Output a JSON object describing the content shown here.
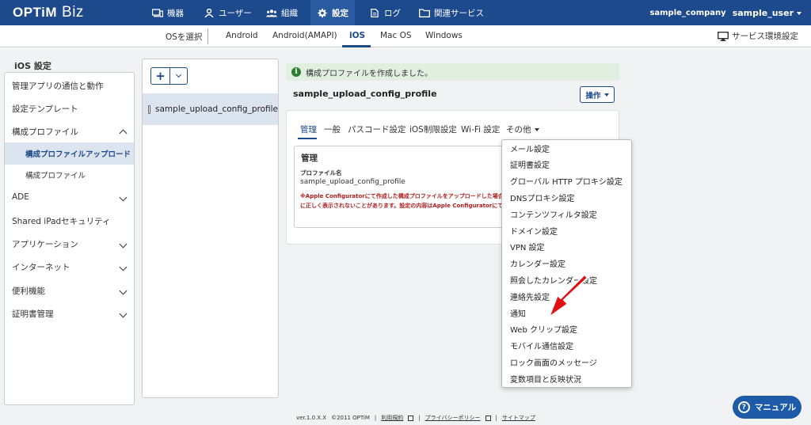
{
  "header": {
    "logo": "OPTiM",
    "logo_suffix": "Biz",
    "nav": [
      {
        "label": "機器",
        "icon": "devices-icon"
      },
      {
        "label": "ユーザー",
        "icon": "user-icon"
      },
      {
        "label": "組織",
        "icon": "organization-icon"
      },
      {
        "label": "設定",
        "icon": "gear-icon"
      },
      {
        "label": "ログ",
        "icon": "log-icon"
      },
      {
        "label": "関連サービス",
        "icon": "folder-icon"
      }
    ],
    "company": "sample_company",
    "user": "sample_user"
  },
  "osbar": {
    "label": "OSを選択",
    "tabs": [
      "Android",
      "Android(AMAPI)",
      "iOS",
      "Mac OS",
      "Windows"
    ],
    "active": "iOS",
    "service_env": "サービス環境設定"
  },
  "sidebar": {
    "title": "iOS 設定",
    "items": [
      {
        "label": "管理アプリの通信と動作"
      },
      {
        "label": "設定テンプレート"
      },
      {
        "label": "構成プロファイル"
      },
      {
        "label": "構成プロファイルアップロード"
      },
      {
        "label": "構成プロファイル"
      },
      {
        "label": "ADE"
      },
      {
        "label": "Shared iPadセキュリティ"
      },
      {
        "label": "アプリケーション"
      },
      {
        "label": "インターネット"
      },
      {
        "label": "便利機能"
      },
      {
        "label": "証明書管理"
      }
    ]
  },
  "list": {
    "add_label": "+",
    "items": [
      {
        "label": "sample_upload_config_profile"
      }
    ]
  },
  "main": {
    "alert": "構成プロファイルを作成しました。",
    "profile_title": "sample_upload_config_profile",
    "ops_button": "操作",
    "tabs": [
      "管理",
      "一般",
      "パスコード設定",
      "iOS制限設定",
      "Wi-Fi 設定",
      "その他"
    ],
    "section_title": "管理",
    "field_label": "プロファイル名",
    "field_value": "sample_upload_config_profile",
    "warning_line1": "※Apple Configuratorにて作成した構成プロファイルをアップロードした場合",
    "warning_line2": "に正しく表示されないことがあります。設定の内容はApple Configuratorにて"
  },
  "dropdown": {
    "items": [
      "メール設定",
      "証明書設定",
      "グローバル HTTP プロキシ設定",
      "DNSプロキシ設定",
      "コンテンツフィルタ設定",
      "ドメイン設定",
      "VPN 設定",
      "カレンダー設定",
      "照会したカレンダー設定",
      "連絡先設定",
      "通知",
      "Web クリップ設定",
      "モバイル通信設定",
      "ロック画面のメッセージ",
      "変数項目と反映状況"
    ]
  },
  "footer": {
    "version": "ver.1.0.X.X",
    "copyright": "©2011 OPTiM",
    "terms": "利用規約",
    "privacy": "プライバシーポリシー",
    "sitemap": "サイトマップ"
  },
  "manual_button": "マニュアル",
  "colors": {
    "primary": "#1d4a8c",
    "alert_bg": "#e1efe1",
    "warning": "#b01c1c",
    "arrow": "#e01010"
  }
}
